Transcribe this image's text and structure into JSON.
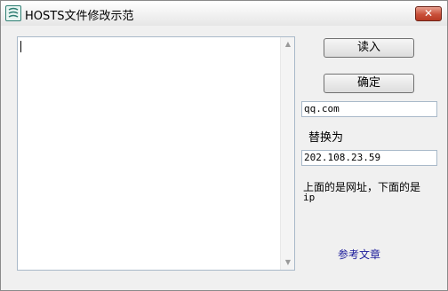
{
  "window": {
    "title": "HOSTS文件修改示范",
    "app_icon": "notes-icon",
    "close_label": "✕"
  },
  "editor": {
    "content": ""
  },
  "buttons": {
    "read_label": "读入",
    "confirm_label": "确定"
  },
  "fields": {
    "find_value": "qq.com",
    "replace_label": "替换为",
    "replace_value": "202.108.23.59"
  },
  "note": {
    "line1": "上面的是网址，下面的是",
    "line2": "ip"
  },
  "link": {
    "label": "参考文章"
  },
  "colors": {
    "window_bg": "#f0f0f0",
    "close_red": "#c9503a",
    "link_blue": "#1a1a9a"
  }
}
